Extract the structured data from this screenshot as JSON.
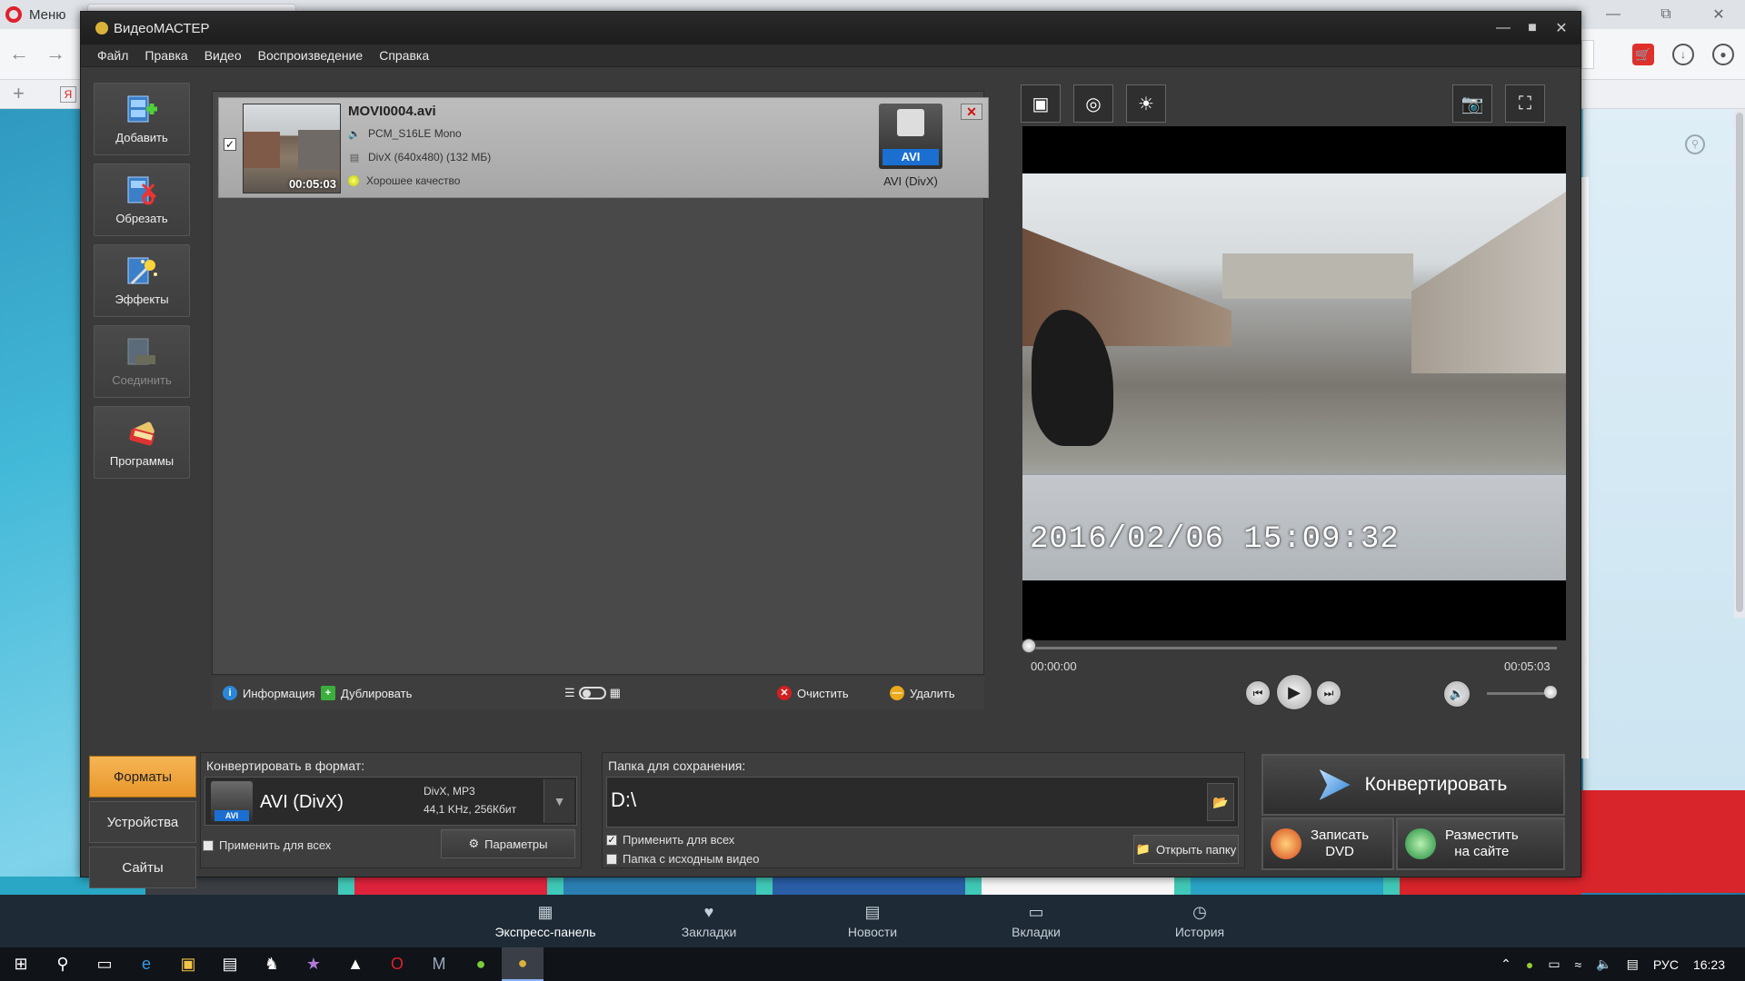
{
  "browser": {
    "menu_label": "Меню",
    "bookmark_ya": "Я",
    "express_panel": [
      {
        "label": "Экспресс-панель",
        "icon": "grid-icon",
        "active": true
      },
      {
        "label": "Закладки",
        "icon": "heart-icon",
        "active": false
      },
      {
        "label": "Новости",
        "icon": "news-icon",
        "active": false
      },
      {
        "label": "Вкладки",
        "icon": "tabs-icon",
        "active": false
      },
      {
        "label": "История",
        "icon": "clock-icon",
        "active": false
      }
    ]
  },
  "window": {
    "title": "ВидеоМАСТЕР",
    "menu": [
      "Файл",
      "Правка",
      "Видео",
      "Воспроизведение",
      "Справка"
    ]
  },
  "sidebar": {
    "items": [
      {
        "label": "Добавить",
        "enabled": true
      },
      {
        "label": "Обрезать",
        "enabled": true
      },
      {
        "label": "Эффекты",
        "enabled": true
      },
      {
        "label": "Соединить",
        "enabled": false
      },
      {
        "label": "Программы",
        "enabled": true
      }
    ]
  },
  "file": {
    "name": "MOVI0004.avi",
    "duration": "00:05:03",
    "audio": "PCM_S16LE Mono",
    "video": "DivX (640x480) (132 МБ)",
    "quality": "Хорошее качество",
    "format_badge": "AVI",
    "format_label": "AVI (DivX)",
    "checked": true
  },
  "list_toolbar": {
    "info": "Информация",
    "duplicate": "Дублировать",
    "clear": "Очистить",
    "delete": "Удалить"
  },
  "player": {
    "timestamp_overlay": "2016/02/06  15:09:32",
    "current_time": "00:00:00",
    "duration": "00:05:03",
    "progress": 0.0,
    "volume": 1.0
  },
  "bottom_tabs": [
    {
      "label": "Форматы",
      "active": true
    },
    {
      "label": "Устройства",
      "active": false
    },
    {
      "label": "Сайты",
      "active": false
    }
  ],
  "format_panel": {
    "title": "Конвертировать в формат:",
    "selected_format": "AVI (DivX)",
    "badge": "AVI",
    "codec": "DivX, MP3",
    "audio": "44,1 KHz, 256Кбит",
    "apply_all": "Применить для всех",
    "params": "Параметры"
  },
  "save_panel": {
    "title": "Папка для сохранения:",
    "path": "D:\\",
    "apply_all": "Применить для всех",
    "apply_all_checked": true,
    "source_folder": "Папка с исходным видео",
    "source_folder_checked": false,
    "open_folder": "Открыть папку"
  },
  "convert": {
    "label": "Конвертировать",
    "burn_dvd": "Записать DVD",
    "burn_dvd_l1": "Записать",
    "burn_dvd_l2": "DVD",
    "upload_l1": "Разместить",
    "upload_l2": "на сайте"
  },
  "taskbar": {
    "language": "РУС",
    "clock": "16:23"
  },
  "colors": {
    "accent_tab": "#f0a43c",
    "badge_blue": "#1b6fd0",
    "close_red": "#d01010"
  }
}
